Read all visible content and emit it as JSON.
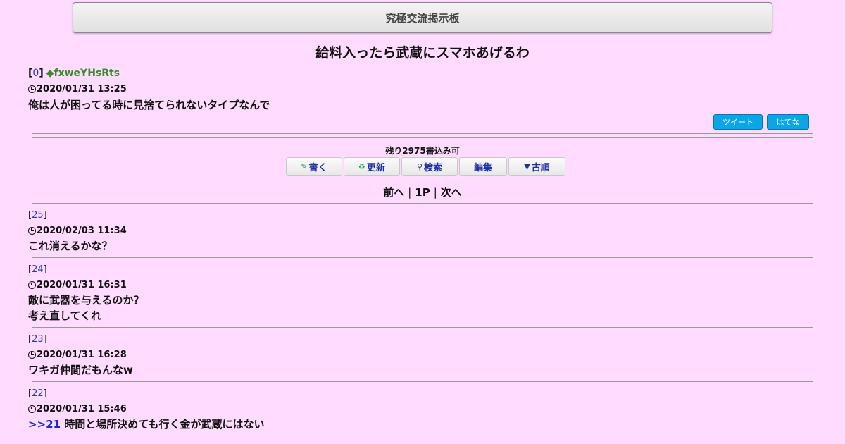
{
  "header": {
    "site_title": "究極交流掲示板"
  },
  "thread": {
    "title": "給料入ったら武蔵にスマホあげるわ",
    "op": {
      "number": "0",
      "trip": "◆fxweYHsRts",
      "date": "2020/01/31 13:25",
      "body": "俺は人が困ってる時に見捨てられないタイプなんで"
    }
  },
  "share": {
    "tweet_label": "ツイート",
    "hatena_label": "はてな"
  },
  "status": {
    "remaining": "残り2975書込み可"
  },
  "toolbar": {
    "write_label": "書く",
    "refresh_label": "更新",
    "search_label": "検索",
    "edit_label": "編集",
    "order_label": "古順",
    "write_icon": "✎",
    "refresh_icon": "♻",
    "search_icon": "⚲",
    "order_icon": "▼"
  },
  "pager": {
    "prev": "前へ",
    "page": "1P",
    "next": "次へ",
    "separator": "|"
  },
  "posts": [
    {
      "number": "25",
      "date": "2020/02/03 11:34",
      "lines": [
        "これ消えるかな？"
      ]
    },
    {
      "number": "24",
      "date": "2020/01/31 16:31",
      "lines": [
        "敵に武器を与えるのか？",
        "考え直してくれ"
      ]
    },
    {
      "number": "23",
      "date": "2020/01/31 16:28",
      "lines": [
        "ワキガ仲間だもんなw"
      ]
    },
    {
      "number": "22",
      "date": "2020/01/31 15:46",
      "anchor": ">>21",
      "lines": [
        "時間と場所決めても行く金が武蔵にはない"
      ]
    }
  ],
  "colors": {
    "background": "#ffdcff",
    "link": "#1f3fbf",
    "trip": "#3a8a2a",
    "share_button": "#0aa6e8"
  }
}
